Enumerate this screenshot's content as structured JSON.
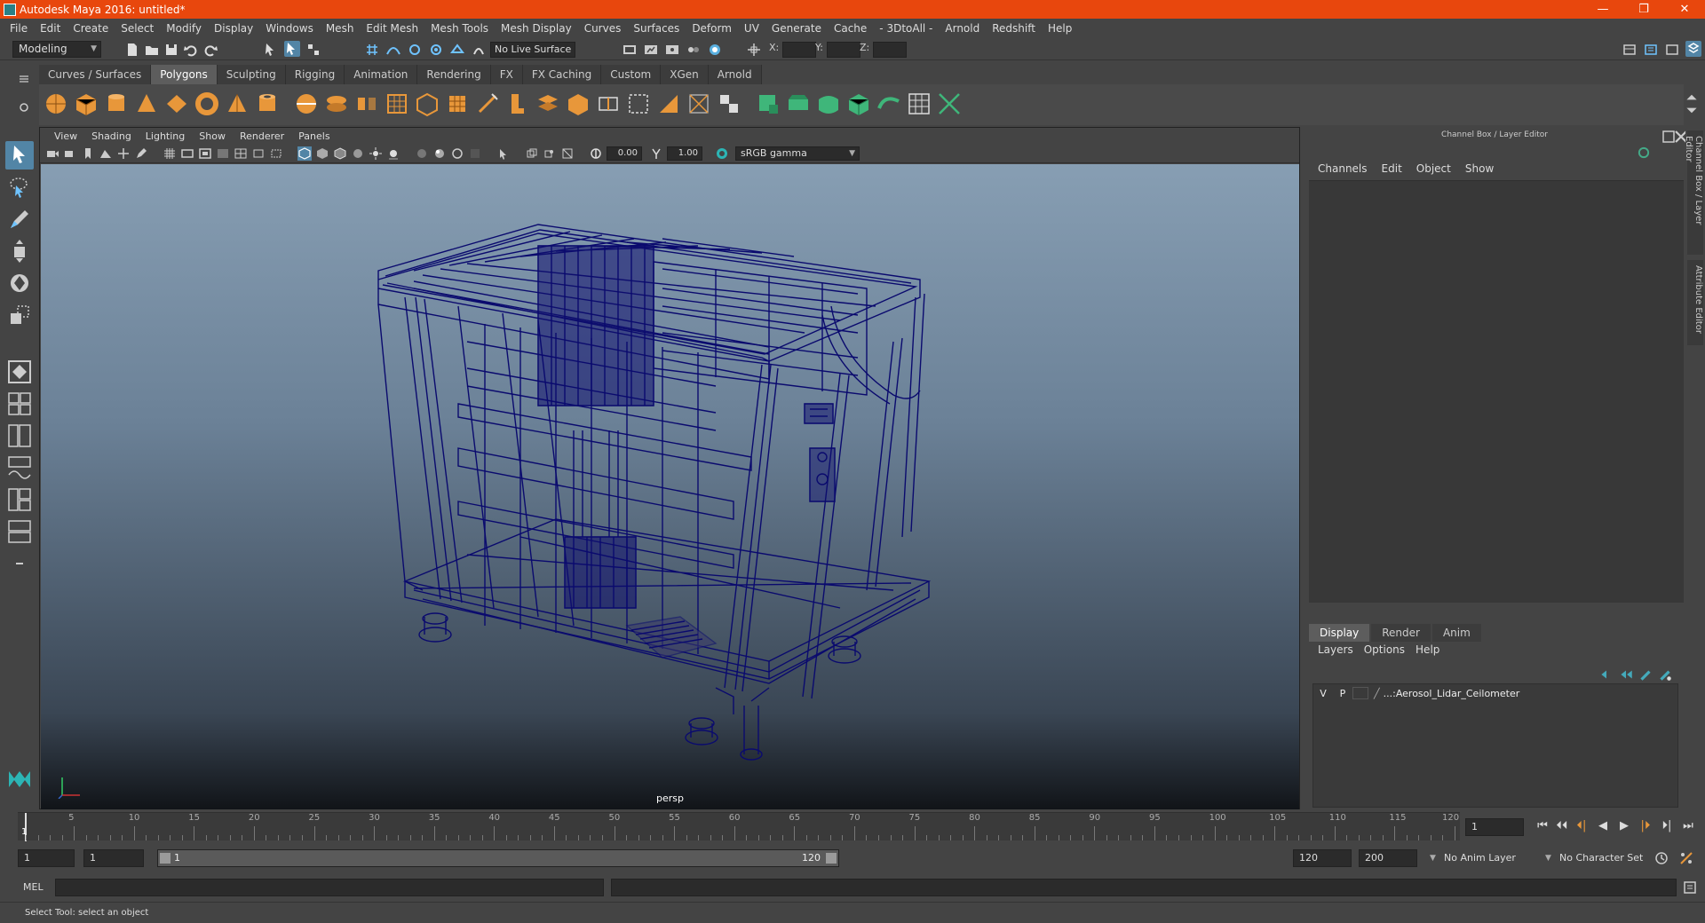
{
  "window": {
    "title": "Autodesk Maya 2016: untitled*",
    "buttons": [
      "—",
      "❐",
      "✕"
    ]
  },
  "menubar": [
    "File",
    "Edit",
    "Create",
    "Select",
    "Modify",
    "Display",
    "Windows",
    "Mesh",
    "Edit Mesh",
    "Mesh Tools",
    "Mesh Display",
    "Curves",
    "Surfaces",
    "Deform",
    "UV",
    "Generate",
    "Cache",
    "- 3DtoAll -",
    "Arnold",
    "Redshift",
    "Help"
  ],
  "statusline": {
    "mode": "Modeling",
    "live_surface": "No Live Surface",
    "x_label": "X:",
    "y_label": "Y:",
    "z_label": "Z:"
  },
  "shelf_tabs": [
    {
      "label": "Curves / Surfaces",
      "active": false
    },
    {
      "label": "Polygons",
      "active": true
    },
    {
      "label": "Sculpting",
      "active": false
    },
    {
      "label": "Rigging",
      "active": false
    },
    {
      "label": "Animation",
      "active": false
    },
    {
      "label": "Rendering",
      "active": false
    },
    {
      "label": "FX",
      "active": false
    },
    {
      "label": "FX Caching",
      "active": false
    },
    {
      "label": "Custom",
      "active": false
    },
    {
      "label": "XGen",
      "active": false
    },
    {
      "label": "Arnold",
      "active": false
    }
  ],
  "viewport": {
    "menus": [
      "View",
      "Shading",
      "Lighting",
      "Show",
      "Renderer",
      "Panels"
    ],
    "near_value": "0.00",
    "far_value": "1.00",
    "color_space": "sRGB gamma",
    "camera_label": "persp"
  },
  "channel_box": {
    "title": "Channel Box / Layer Editor",
    "menus": [
      "Channels",
      "Edit",
      "Object",
      "Show"
    ]
  },
  "layer_editor": {
    "tabs": [
      {
        "label": "Display",
        "active": true
      },
      {
        "label": "Render",
        "active": false
      },
      {
        "label": "Anim",
        "active": false
      }
    ],
    "menus": [
      "Layers",
      "Options",
      "Help"
    ],
    "layers": [
      {
        "v": "V",
        "p": "P",
        "name": "...:Aerosol_Lidar_Ceilometer"
      }
    ]
  },
  "side_tabs": [
    "Channel Box / Layer Editor",
    "Attribute Editor"
  ],
  "timeline": {
    "labels": [
      "5",
      "10",
      "15",
      "20",
      "25",
      "30",
      "35",
      "40",
      "45",
      "50",
      "55",
      "60",
      "65",
      "70",
      "75",
      "80",
      "85",
      "90",
      "95",
      "100",
      "105",
      "110",
      "115",
      "120"
    ],
    "current_frame": "1",
    "current_frame_field": "1"
  },
  "range": {
    "start_field": "1",
    "start_field2": "1",
    "slider_start": "1",
    "slider_end": "120",
    "end_field": "120",
    "end_field2": "200",
    "anim_layer": "No Anim Layer",
    "character_set": "No Character Set"
  },
  "mel": {
    "label": "MEL"
  },
  "help_line": "Select Tool: select an object",
  "colors": {
    "title_bar": "#e8470d",
    "selected_tool": "#5285a6",
    "wireframe": "#0a0a6e"
  }
}
